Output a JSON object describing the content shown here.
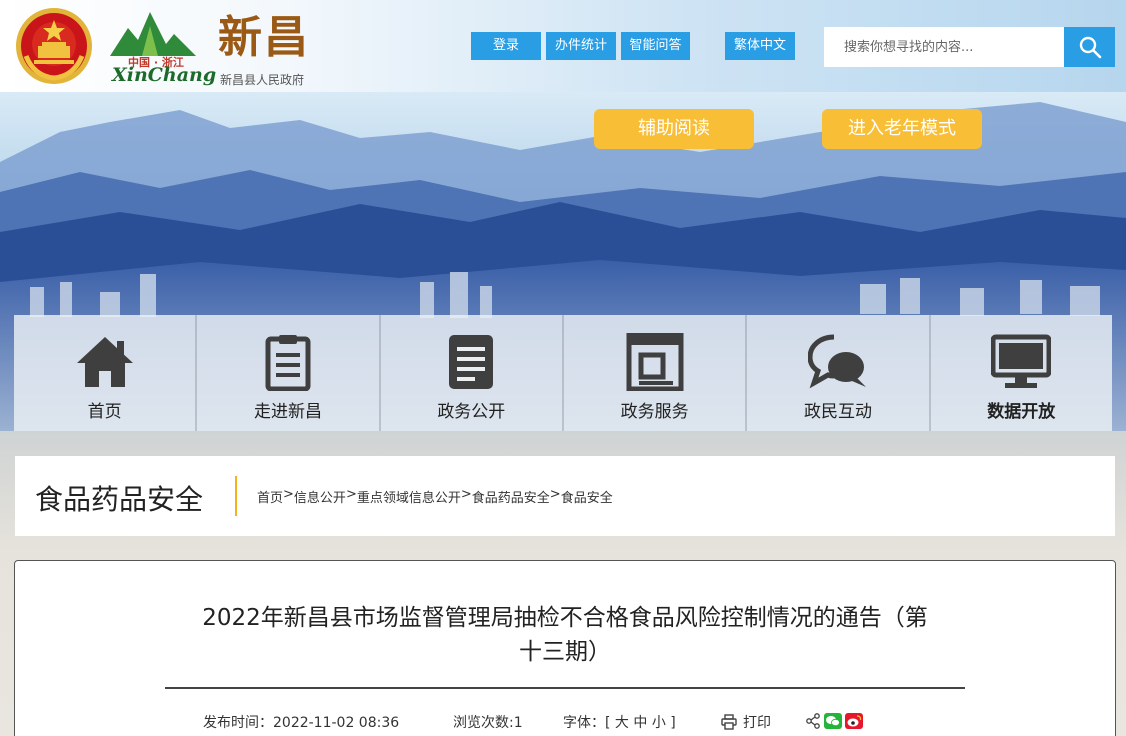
{
  "header": {
    "logo_cn_small": "中国 · 浙江",
    "logo_en": "XinChang",
    "logo_big": "新昌",
    "logo_sub": "新昌县人民政府",
    "buttons": {
      "login": "登录",
      "stats": "办件统计",
      "qa": "智能问答",
      "traditional": "繁体中文"
    },
    "search": {
      "placeholder": "搜索你想寻找的内容..."
    }
  },
  "banner": {
    "assist_read": "辅助阅读",
    "elder_mode": "进入老年模式"
  },
  "nav": {
    "items": [
      {
        "label": "首页",
        "icon": "home-icon"
      },
      {
        "label": "走进新昌",
        "icon": "clipboard-icon"
      },
      {
        "label": "政务公开",
        "icon": "document-icon"
      },
      {
        "label": "政务服务",
        "icon": "service-icon"
      },
      {
        "label": "政民互动",
        "icon": "chat-icon"
      },
      {
        "label": "数据开放",
        "icon": "monitor-icon"
      }
    ]
  },
  "section": {
    "title": "食品药品安全",
    "breadcrumb": [
      "首页",
      "信息公开",
      "重点领域信息公开",
      "食品药品安全",
      "食品安全"
    ],
    "separator": ">"
  },
  "article": {
    "title_line1": "2022年新昌县市场监督管理局抽检不合格食品风险控制情况的通告（第",
    "title_line2": "十三期）",
    "publish_label": "发布时间：",
    "publish_time": "2022-11-02 08:36",
    "views_label": "浏览次数:",
    "views": "1",
    "font_label": "字体：[",
    "font_large": "大",
    "font_medium": "中",
    "font_small": "小",
    "font_close": "]",
    "print": "打印"
  },
  "colors": {
    "accent_blue": "#2a9ee5",
    "gold": "#f8be36",
    "divider": "#f3b21f"
  }
}
